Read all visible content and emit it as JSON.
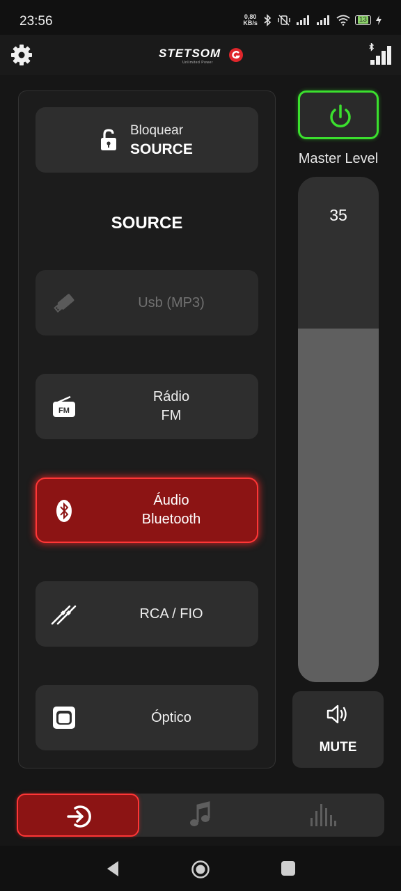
{
  "status_bar": {
    "time": "23:56",
    "net_speed_value": "0,80",
    "net_speed_unit": "KB/s",
    "battery": "13"
  },
  "app_bar": {
    "brand": "STETSOM",
    "tagline": "Unlimited Power",
    "gear_icon": "gear-icon",
    "bt_signal_icon": "bluetooth-signal-icon"
  },
  "source_panel": {
    "lock_button": {
      "line1": "Bloquear",
      "line2": "SOURCE",
      "icon": "unlock-icon"
    },
    "title": "SOURCE",
    "sources": [
      {
        "line1": "Usb (MP3)",
        "line2": "",
        "icon": "usb-icon",
        "state": "disabled"
      },
      {
        "line1": "Rádio",
        "line2": "FM",
        "icon": "radio-fm-icon",
        "state": "normal"
      },
      {
        "line1": "Áudio",
        "line2": "Bluetooth",
        "icon": "bluetooth-icon",
        "state": "active"
      },
      {
        "line1": "RCA / FIO",
        "line2": "",
        "icon": "rca-cable-icon",
        "state": "normal"
      },
      {
        "line1": "Óptico",
        "line2": "",
        "icon": "optical-icon",
        "state": "normal"
      }
    ]
  },
  "master": {
    "label": "Master Level",
    "value": "35",
    "fill_fraction": 0.7,
    "mute_label": "MUTE",
    "power_icon": "power-icon",
    "mute_icon": "speaker-icon"
  },
  "bottom_nav": {
    "tabs": [
      {
        "name": "source",
        "icon": "input-icon",
        "active": true
      },
      {
        "name": "music",
        "icon": "music-note-icon",
        "active": false
      },
      {
        "name": "equalizer",
        "icon": "equalizer-icon",
        "active": false
      }
    ]
  },
  "colors": {
    "accent_red": "#8c1414",
    "accent_red_border": "#ff3636",
    "power_green": "#3be02e",
    "background": "#161616"
  }
}
